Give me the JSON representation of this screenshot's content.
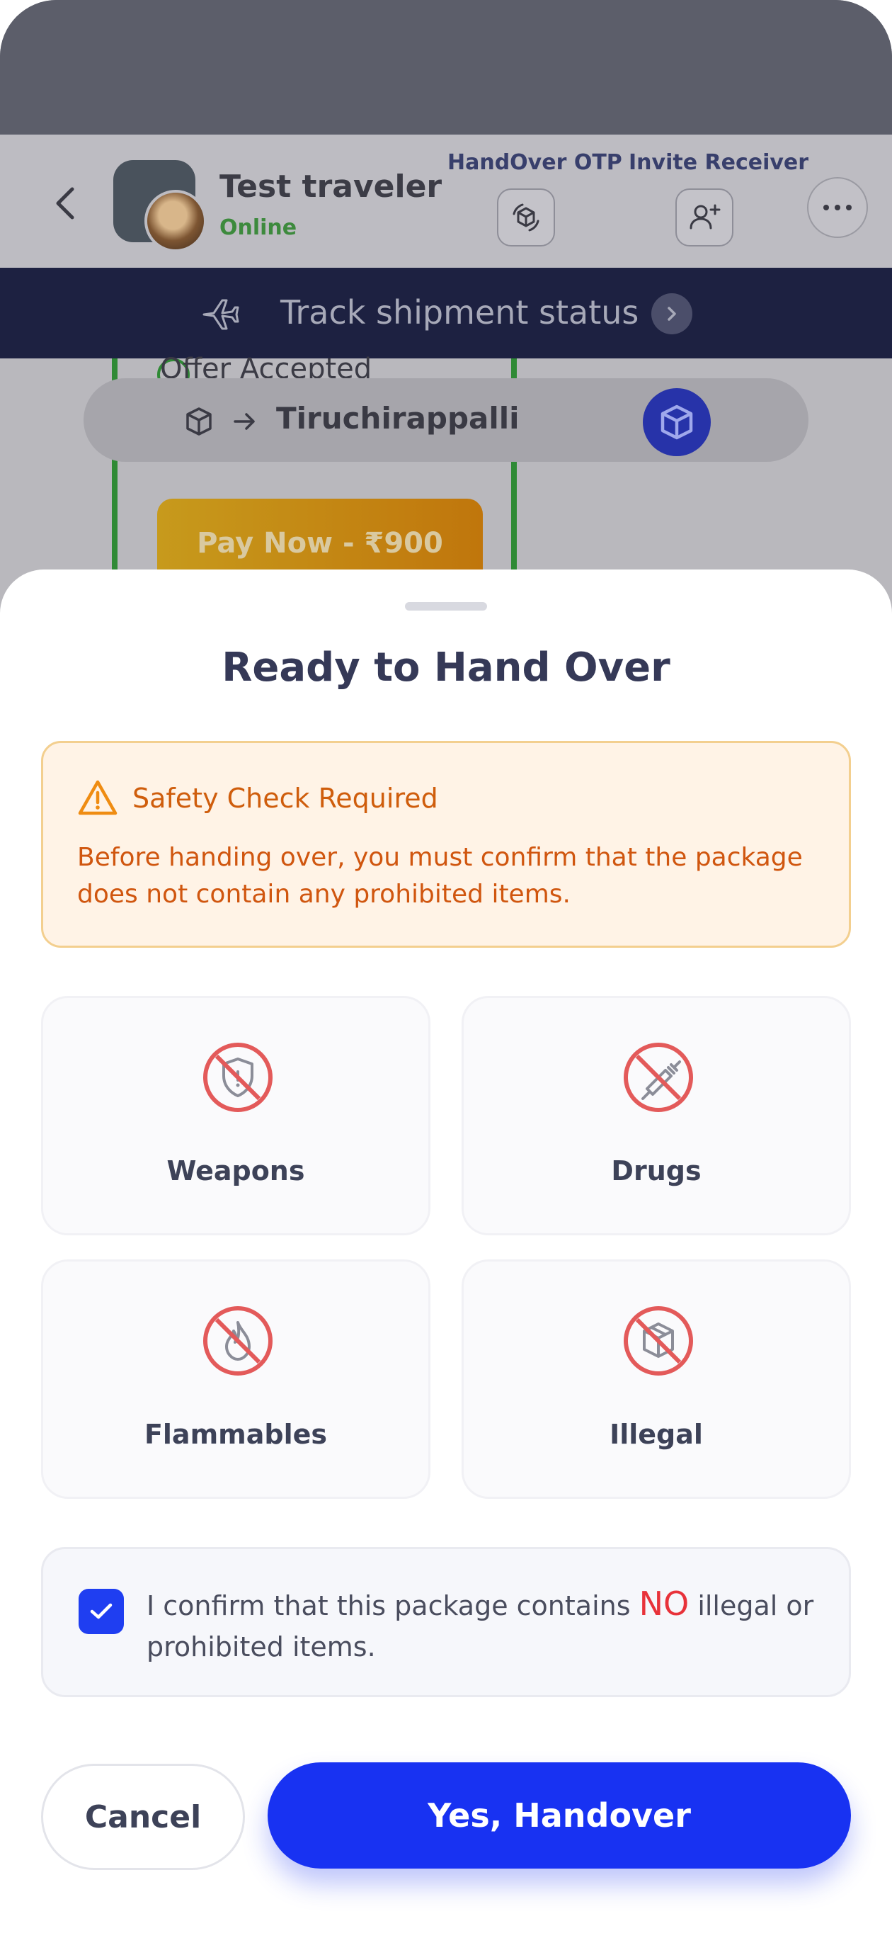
{
  "chat_header": {
    "traveler_name": "Test traveler",
    "status": "Online",
    "handover_otp_label": "HandOver OTP",
    "invite_receiver_label": "Invite Receiver"
  },
  "track_banner": {
    "label": "Track shipment status"
  },
  "chat_card": {
    "offer_status": "Offer Accepted",
    "route_city": "Tiruchirappalli",
    "pay_button": "Pay Now - ₹900"
  },
  "sheet": {
    "title": "Ready to Hand Over",
    "warning_title": "Safety Check Required",
    "warning_message": "Before handing over, you must confirm that the package does not contain any prohibited items.",
    "prohibited_items": [
      {
        "label": "Weapons",
        "icon": "no-weapons-icon"
      },
      {
        "label": "Drugs",
        "icon": "no-drugs-icon"
      },
      {
        "label": "Flammables",
        "icon": "no-flammables-icon"
      },
      {
        "label": "Illegal",
        "icon": "no-illegal-icon"
      }
    ],
    "confirm_text_before": "I confirm that this package contains ",
    "confirm_text_no": "NO",
    "confirm_text_after": " illegal or prohibited items.",
    "confirm_checked": true,
    "cancel_label": "Cancel",
    "handover_label": "Yes, Handover"
  },
  "colors": {
    "primary": "#1832f2",
    "warning_text": "#d0560f",
    "warning_bg": "#fff3e6",
    "prohibited_red": "#e35a5a",
    "banner_bg": "#1d2141"
  }
}
